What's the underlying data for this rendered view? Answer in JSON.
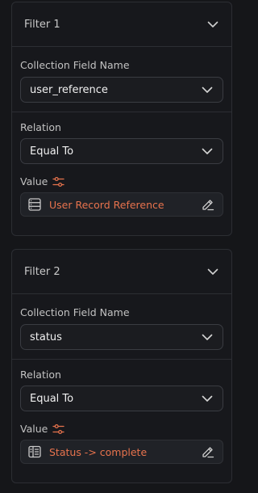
{
  "filters": [
    {
      "title": "Filter 1",
      "field_label": "Collection Field Name",
      "field_value": "user_reference",
      "relation_label": "Relation",
      "relation_value": "Equal To",
      "value_label": "Value",
      "value_text": "User Record Reference",
      "value_icon": "database-icon"
    },
    {
      "title": "Filter 2",
      "field_label": "Collection Field Name",
      "field_value": "status",
      "relation_label": "Relation",
      "relation_value": "Equal To",
      "value_label": "Value",
      "value_text": "Status -> complete",
      "value_icon": "document-list-icon"
    }
  ],
  "colors": {
    "accent": "#e8734d",
    "background": "#151619",
    "card": "#17181c",
    "border": "#2c2e33"
  }
}
